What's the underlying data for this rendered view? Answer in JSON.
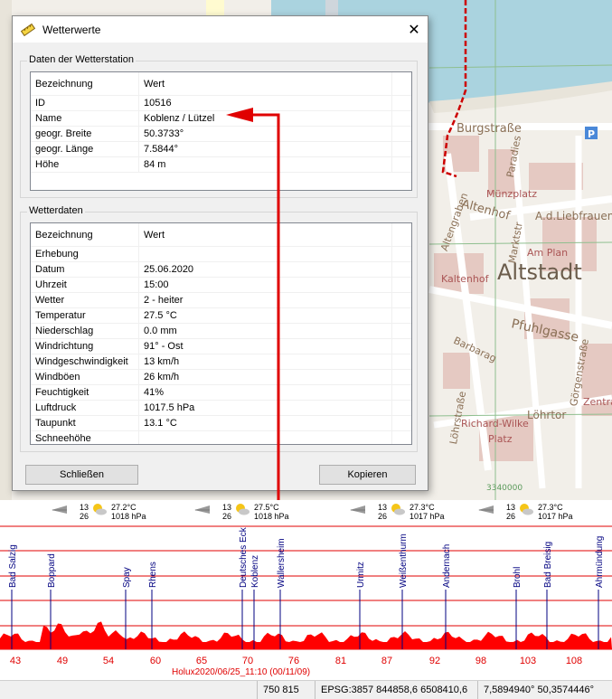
{
  "map": {
    "labels": {
      "altstadt": "Altstadt",
      "burgstrasse": "Burgstraße",
      "altenhof": "Altenhof",
      "muenzplatz": "Münzplatz",
      "am_plan": "Am Plan",
      "kaltenhof": "Kaltenhof",
      "pfuhlgasse": "Pfuhlgasse",
      "loehrstrasse": "Löhrstraße",
      "richard_wilke": "Richard-Wilke",
      "loehrtor": "Löhrtor",
      "zentral": "Zentra",
      "liebfrauen": "A.d.Liebfrauen",
      "marktstr": "Marktstr",
      "paradies": "Paradies",
      "altengraben": "Altengraben",
      "gorgenstrasse": "Görgenstraße",
      "barbarag": "Barbarag",
      "platz": "Platz",
      "coord": "3340000"
    }
  },
  "dialog": {
    "title": "Wetterwerte",
    "close_glyph": "✕",
    "station_group": "Daten der Wetterstation",
    "station_header": [
      "Bezeichnung",
      "Wert"
    ],
    "station_rows": [
      [
        "ID",
        "10516"
      ],
      [
        "Name",
        "Koblenz / Lützel"
      ],
      [
        "geogr. Breite",
        "50.3733°"
      ],
      [
        "geogr. Länge",
        "7.5844°"
      ],
      [
        "Höhe",
        "84 m"
      ]
    ],
    "weather_group": "Wetterdaten",
    "weather_header": [
      "Bezeichnung",
      "Wert"
    ],
    "weather_rows": [
      [
        "Erhebung",
        ""
      ],
      [
        "Datum",
        "25.06.2020"
      ],
      [
        "Uhrzeit",
        "15:00"
      ],
      [
        "Wetter",
        "2 - heiter"
      ],
      [
        "Temperatur",
        "27.5 °C"
      ],
      [
        "Niederschlag",
        "0.0 mm"
      ],
      [
        "Windrichtung",
        "91° - Ost"
      ],
      [
        "Windgeschwindigkeit",
        "13 km/h"
      ],
      [
        "Windböen",
        "26 km/h"
      ],
      [
        "Feuchtigkeit",
        "41%"
      ],
      [
        "Luftdruck",
        "1017.5 hPa"
      ],
      [
        "Taupunkt",
        "13.1 °C"
      ],
      [
        "Schneehöhe",
        ""
      ]
    ],
    "close_button": "Schließen",
    "copy_button": "Kopieren"
  },
  "weather_strip": [
    {
      "n1": "13",
      "n2": "26",
      "temp": "27.2°C",
      "press": "1018 hPa"
    },
    {
      "n1": "13",
      "n2": "26",
      "temp": "27.5°C",
      "press": "1018 hPa"
    },
    {
      "n1": "13",
      "n2": "26",
      "temp": "27.3°C",
      "press": "1017 hPa"
    },
    {
      "n1": "13",
      "n2": "26",
      "temp": "27.3°C",
      "press": "1017 hPa"
    }
  ],
  "profile": {
    "places": [
      "Bad Salzig",
      "Boppard",
      "Spay",
      "Rhens",
      "Deutsches Eck",
      "Koblenz",
      "Wallersheim",
      "Urmitz",
      "Weißenthurm",
      "Andernach",
      "Brohl",
      "Bad Breisig",
      "Ahrmündung"
    ],
    "ticks": [
      "43",
      "49",
      "54",
      "60",
      "65",
      "70",
      "76",
      "81",
      "87",
      "92",
      "98",
      "103",
      "108"
    ],
    "track_label": "Holux2020/06/25_11:10 (00/11/09)",
    "fill_color": "#ff0000",
    "line_color": "#000080"
  },
  "statusbar": {
    "pos": "750  815",
    "epsg": "EPSG:3857 844858,6  6508410,6",
    "geo": "7,5894940° 50,3574446°"
  }
}
